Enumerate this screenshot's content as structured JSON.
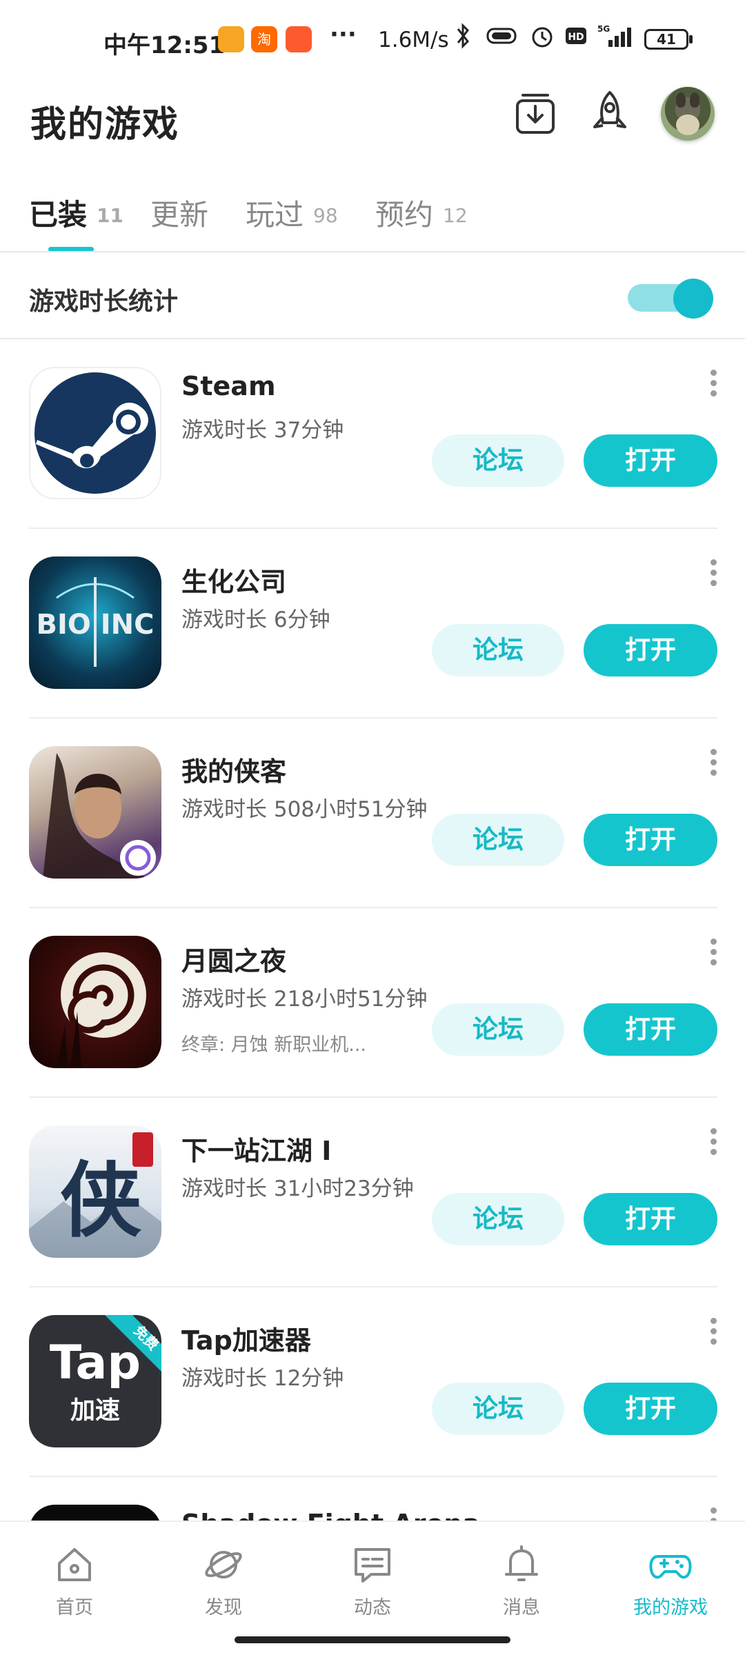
{
  "status_bar": {
    "time": "中午12:51",
    "more": "···",
    "net_speed": "1.6M/s",
    "battery": "41",
    "app_icons": [
      {
        "name": "notes-app-icon",
        "color": "#f6a623",
        "text": ""
      },
      {
        "name": "taobao-app-icon",
        "color": "#ff6a00",
        "text": "淘"
      },
      {
        "name": "tmall-app-icon",
        "color": "#ff5a2e",
        "text": ""
      }
    ]
  },
  "header": {
    "title": "我的游戏",
    "download_icon": "download-manager-icon",
    "rocket_icon": "rocket-boost-icon",
    "avatar": "user-avatar"
  },
  "tabs": [
    {
      "label": "已装",
      "count": "11",
      "active": true
    },
    {
      "label": "更新",
      "count": ""
    },
    {
      "label": "玩过",
      "count": "98"
    },
    {
      "label": "预约",
      "count": "12"
    }
  ],
  "playtime_stats": {
    "label": "游戏时长统计",
    "enabled": true
  },
  "games": [
    {
      "name": "Steam",
      "time": "游戏时长 37分钟",
      "note": "",
      "icon": "steam-icon"
    },
    {
      "name": "生化公司",
      "time": "游戏时长 6分钟",
      "note": "",
      "icon": "bio-inc-icon",
      "icon_text": "BIO INC"
    },
    {
      "name": "我的侠客",
      "time": "游戏时长 508小时51分钟",
      "note": "",
      "icon": "my-hero-icon"
    },
    {
      "name": "月圆之夜",
      "time": "游戏时长 218小时51分钟",
      "note": "终章: 月蚀 新职业机...",
      "icon": "full-moon-night-icon"
    },
    {
      "name": "下一站江湖 I",
      "time": "游戏时长 31小时23分钟",
      "note": "",
      "icon": "next-stop-jianghu-icon",
      "icon_text": "侠"
    },
    {
      "name": "Tap加速器",
      "time": "游戏时长 12分钟",
      "note": "",
      "icon": "tap-accelerator-icon",
      "icon_text": "Tap",
      "icon_text2": "加速",
      "badge": "免费"
    },
    {
      "name": "Shadow Fight Arena",
      "time": "",
      "note": "",
      "icon": "shadow-fight-arena-icon"
    }
  ],
  "buttons": {
    "forum": "论坛",
    "open": "打开"
  },
  "nav": [
    {
      "label": "首页",
      "icon": "home-icon"
    },
    {
      "label": "发现",
      "icon": "discover-planet-icon"
    },
    {
      "label": "动态",
      "icon": "feed-message-icon"
    },
    {
      "label": "消息",
      "icon": "bell-icon"
    },
    {
      "label": "我的游戏",
      "icon": "gamepad-icon",
      "active": true
    }
  ],
  "colors": {
    "accent": "#15c5ce",
    "forum_bg": "#e4f8fa"
  }
}
